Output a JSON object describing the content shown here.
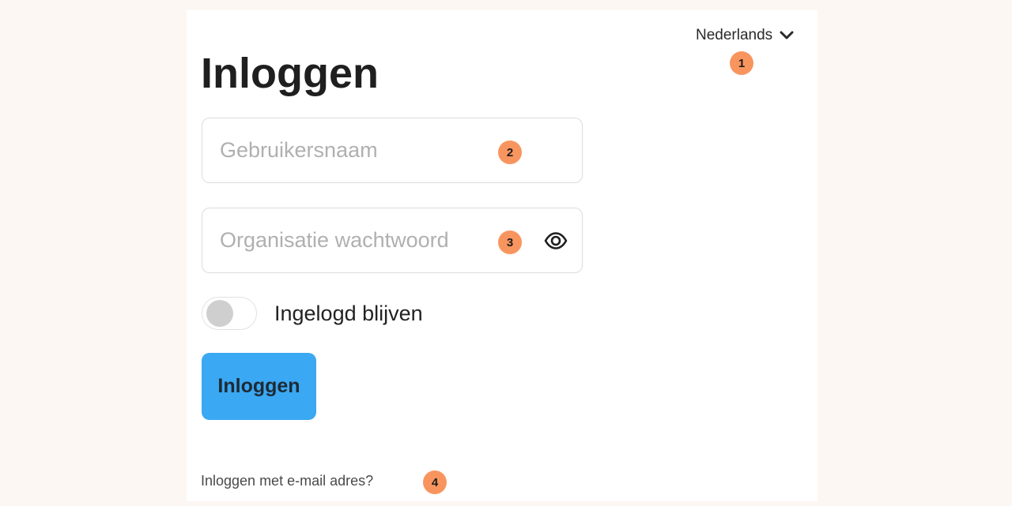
{
  "language_selector": {
    "label": "Nederlands",
    "icon": "chevron-down-icon"
  },
  "page": {
    "title": "Inloggen"
  },
  "form": {
    "username": {
      "value": "",
      "placeholder": "Gebruikersnaam"
    },
    "password": {
      "value": "",
      "placeholder": "Organisatie wachtwoord",
      "visibility_icon": "eye-icon"
    },
    "remember_me": {
      "label": "Ingelogd blijven",
      "checked": false
    },
    "submit_label": "Inloggen",
    "email_login_link": "Inloggen met e-mail adres?"
  },
  "annotations": [
    "1",
    "2",
    "3",
    "4"
  ],
  "colors": {
    "page_background": "#fdf7f3",
    "card_background": "#ffffff",
    "primary_button": "#3aa8f2",
    "annotation_badge": "#f8955f",
    "toggle_knob_off": "#cfcfcf"
  }
}
